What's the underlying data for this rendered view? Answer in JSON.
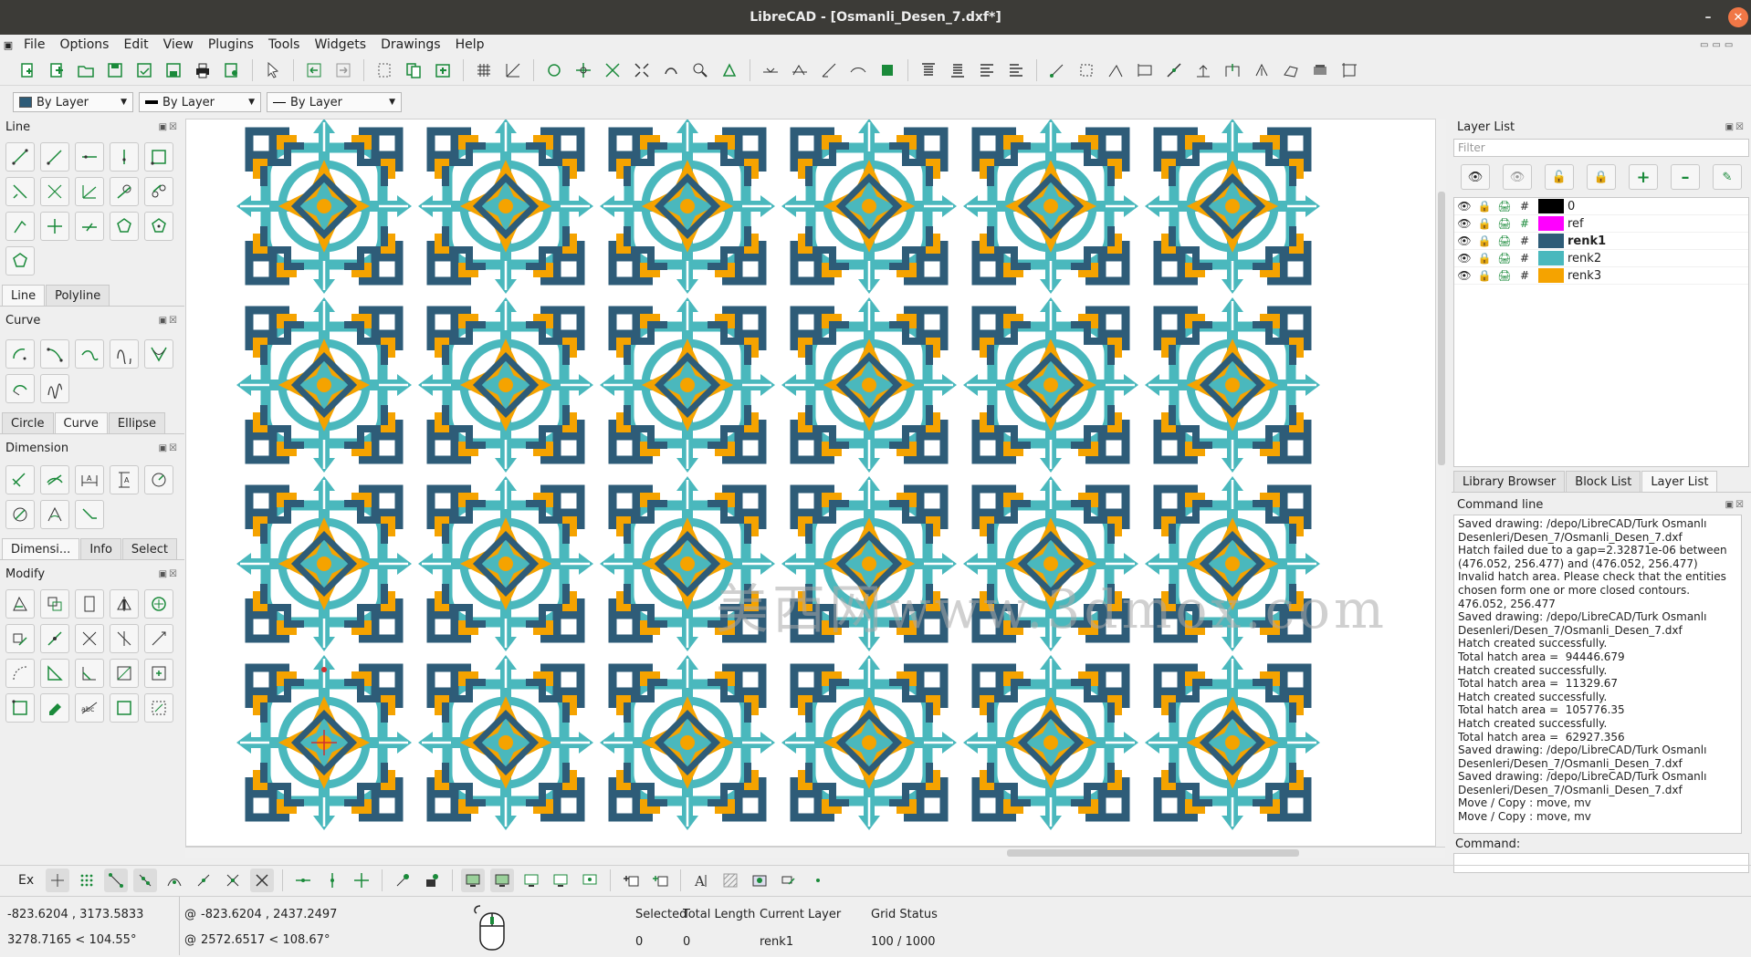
{
  "window": {
    "title": "LibreCAD - [Osmanli_Desen_7.dxf*]"
  },
  "menu": [
    "File",
    "Options",
    "Edit",
    "View",
    "Plugins",
    "Tools",
    "Widgets",
    "Drawings",
    "Help"
  ],
  "pen": {
    "color": "By Layer",
    "width": "By Layer",
    "linetype": "By Layer"
  },
  "left_dock": {
    "line": {
      "title": "Line",
      "tabs": [
        "Line",
        "Polyline"
      ]
    },
    "curve": {
      "title": "Curve",
      "tabs": [
        "Circle",
        "Curve",
        "Ellipse"
      ]
    },
    "dimension": {
      "title": "Dimension",
      "tabs": [
        "Dimensi...",
        "Info",
        "Select"
      ]
    },
    "modify": {
      "title": "Modify"
    }
  },
  "right_dock": {
    "layer_list_title": "Layer List",
    "filter_placeholder": "Filter",
    "layers": [
      {
        "name": "0",
        "color": "#000000",
        "bold": false
      },
      {
        "name": "ref",
        "color": "#ff00ff",
        "bold": false
      },
      {
        "name": "renk1",
        "color": "#2e5c78",
        "bold": true
      },
      {
        "name": "renk2",
        "color": "#4ab8bd",
        "bold": false
      },
      {
        "name": "renk3",
        "color": "#f5a300",
        "bold": false
      }
    ],
    "tabs": [
      "Library Browser",
      "Block List",
      "Layer List"
    ],
    "command_title": "Command line",
    "command_log": "Saved drawing: /depo/LibreCAD/Turk Osmanlı\nDesenleri/Desen_7/Osmanli_Desen_7.dxf\nHatch failed due to a gap=2.32871e-06 between\n(476.052, 256.477) and (476.052, 256.477)\nInvalid hatch area. Please check that the entities\nchosen form one or more closed contours.\n476.052, 256.477\nSaved drawing: /depo/LibreCAD/Turk Osmanlı\nDesenleri/Desen_7/Osmanli_Desen_7.dxf\nHatch created successfully.\nTotal hatch area =  94446.679\nHatch created successfully.\nTotal hatch area =  11329.67\nHatch created successfully.\nTotal hatch area =  105776.35\nHatch created successfully.\nTotal hatch area =  62927.356\nSaved drawing: /depo/LibreCAD/Turk Osmanlı\nDesenleri/Desen_7/Osmanli_Desen_7.dxf\nSaved drawing: /depo/LibreCAD/Turk Osmanlı\nDesenleri/Desen_7/Osmanli_Desen_7.dxf\nMove / Copy : move, mv\nMove / Copy : move, mv",
    "command_label": "Command:"
  },
  "canvas": {
    "tile_colors": {
      "dark": "#2e5c78",
      "teal": "#4ab8bd",
      "orange": "#f5a300"
    },
    "watermark": "美西网www.3dmox.com"
  },
  "snapbar": {
    "ex_label": "Ex"
  },
  "status": {
    "abs_coord": "-823.6204 , 3173.5833",
    "abs_polar": "3278.7165 < 104.55°",
    "rel_coord": "-823.6204 , 2437.2497",
    "rel_polar": "2572.6517 < 108.67°",
    "at1": "@",
    "at2": "@",
    "selected_label": "Selected",
    "selected_value": "0",
    "total_length_label": "Total Length",
    "total_length_value": "0",
    "current_layer_label": "Current Layer",
    "current_layer_value": "renk1",
    "grid_status_label": "Grid Status",
    "grid_status_value": "100 / 1000"
  }
}
